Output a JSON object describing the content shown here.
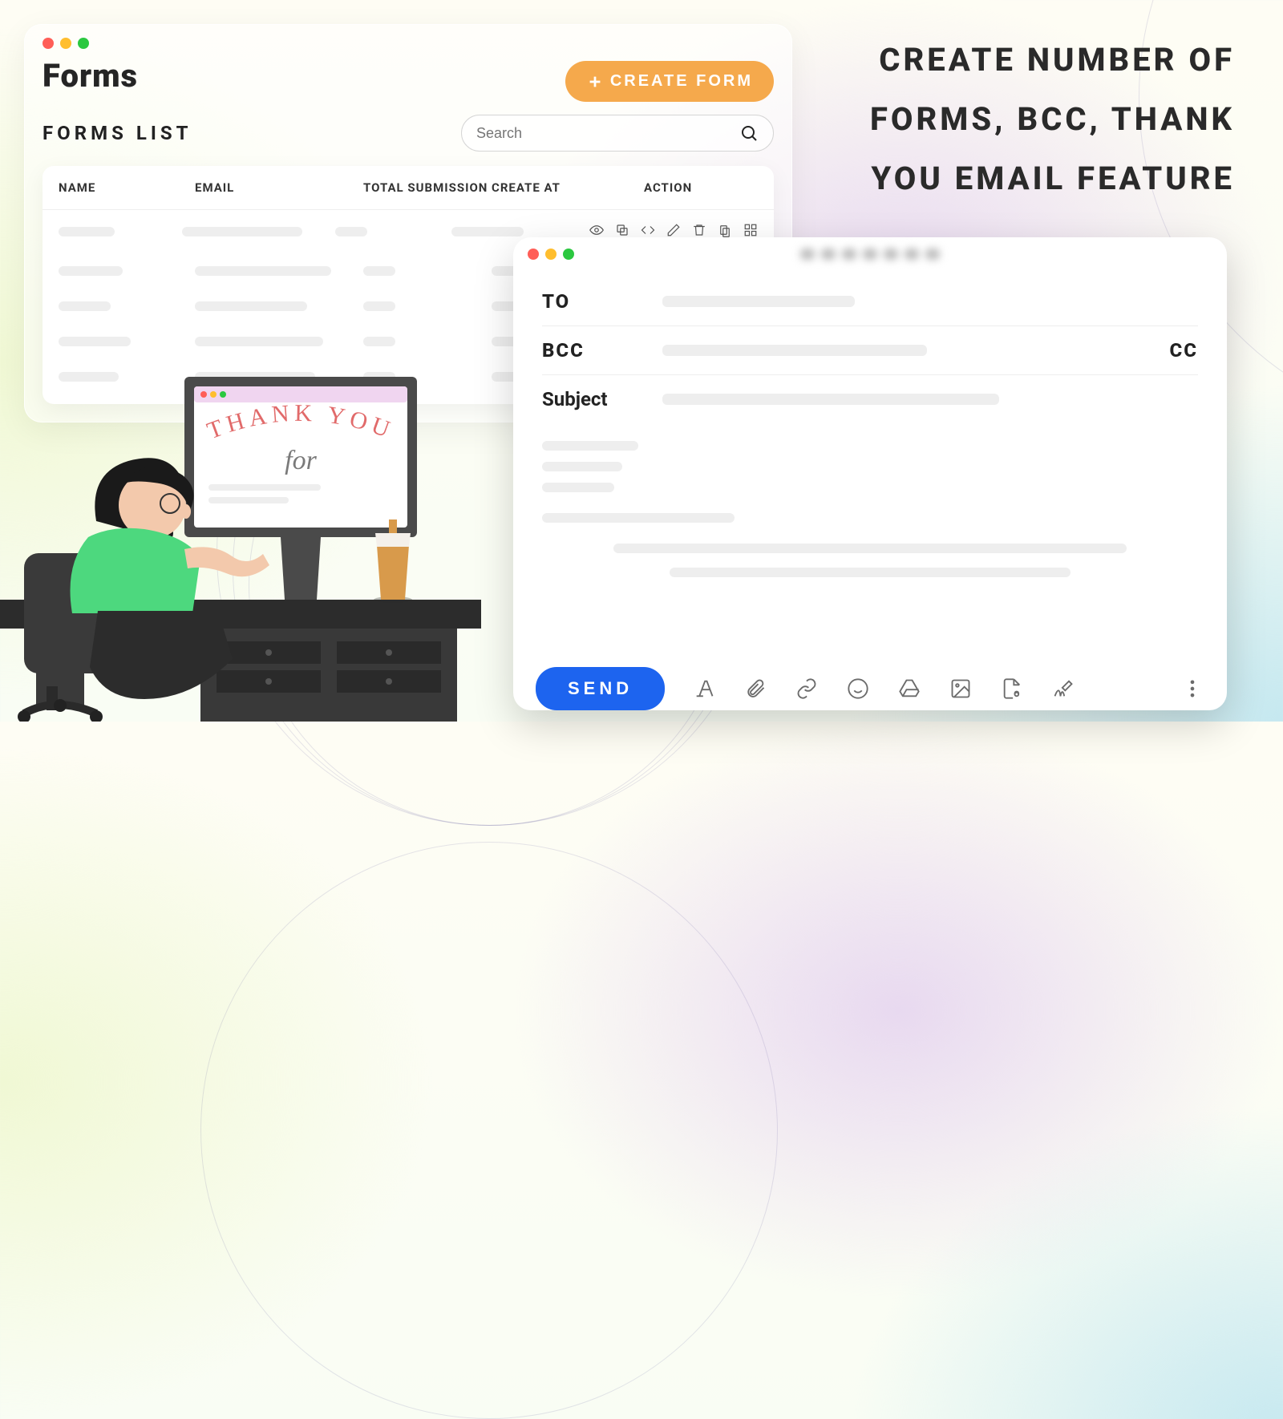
{
  "headline": "CREATE NUMBER OF FORMS, BCC, THANK YOU EMAIL FEATURE",
  "forms": {
    "title": "Forms",
    "subtitle": "FORMS LIST",
    "create_label": "CREATE FORM",
    "search_placeholder": "Search",
    "columns": {
      "name": "NAME",
      "email": "EMAIL",
      "total": "TOTAL SUBMISSION",
      "created": "CREATE AT",
      "action": "ACTION"
    }
  },
  "email": {
    "to_label": "TO",
    "bcc_label": "BCC",
    "cc_label": "CC",
    "subject_label": "Subject",
    "send_label": "SEND"
  },
  "illustration": {
    "screen_text": "THANK YOU",
    "screen_subtext": "for"
  }
}
